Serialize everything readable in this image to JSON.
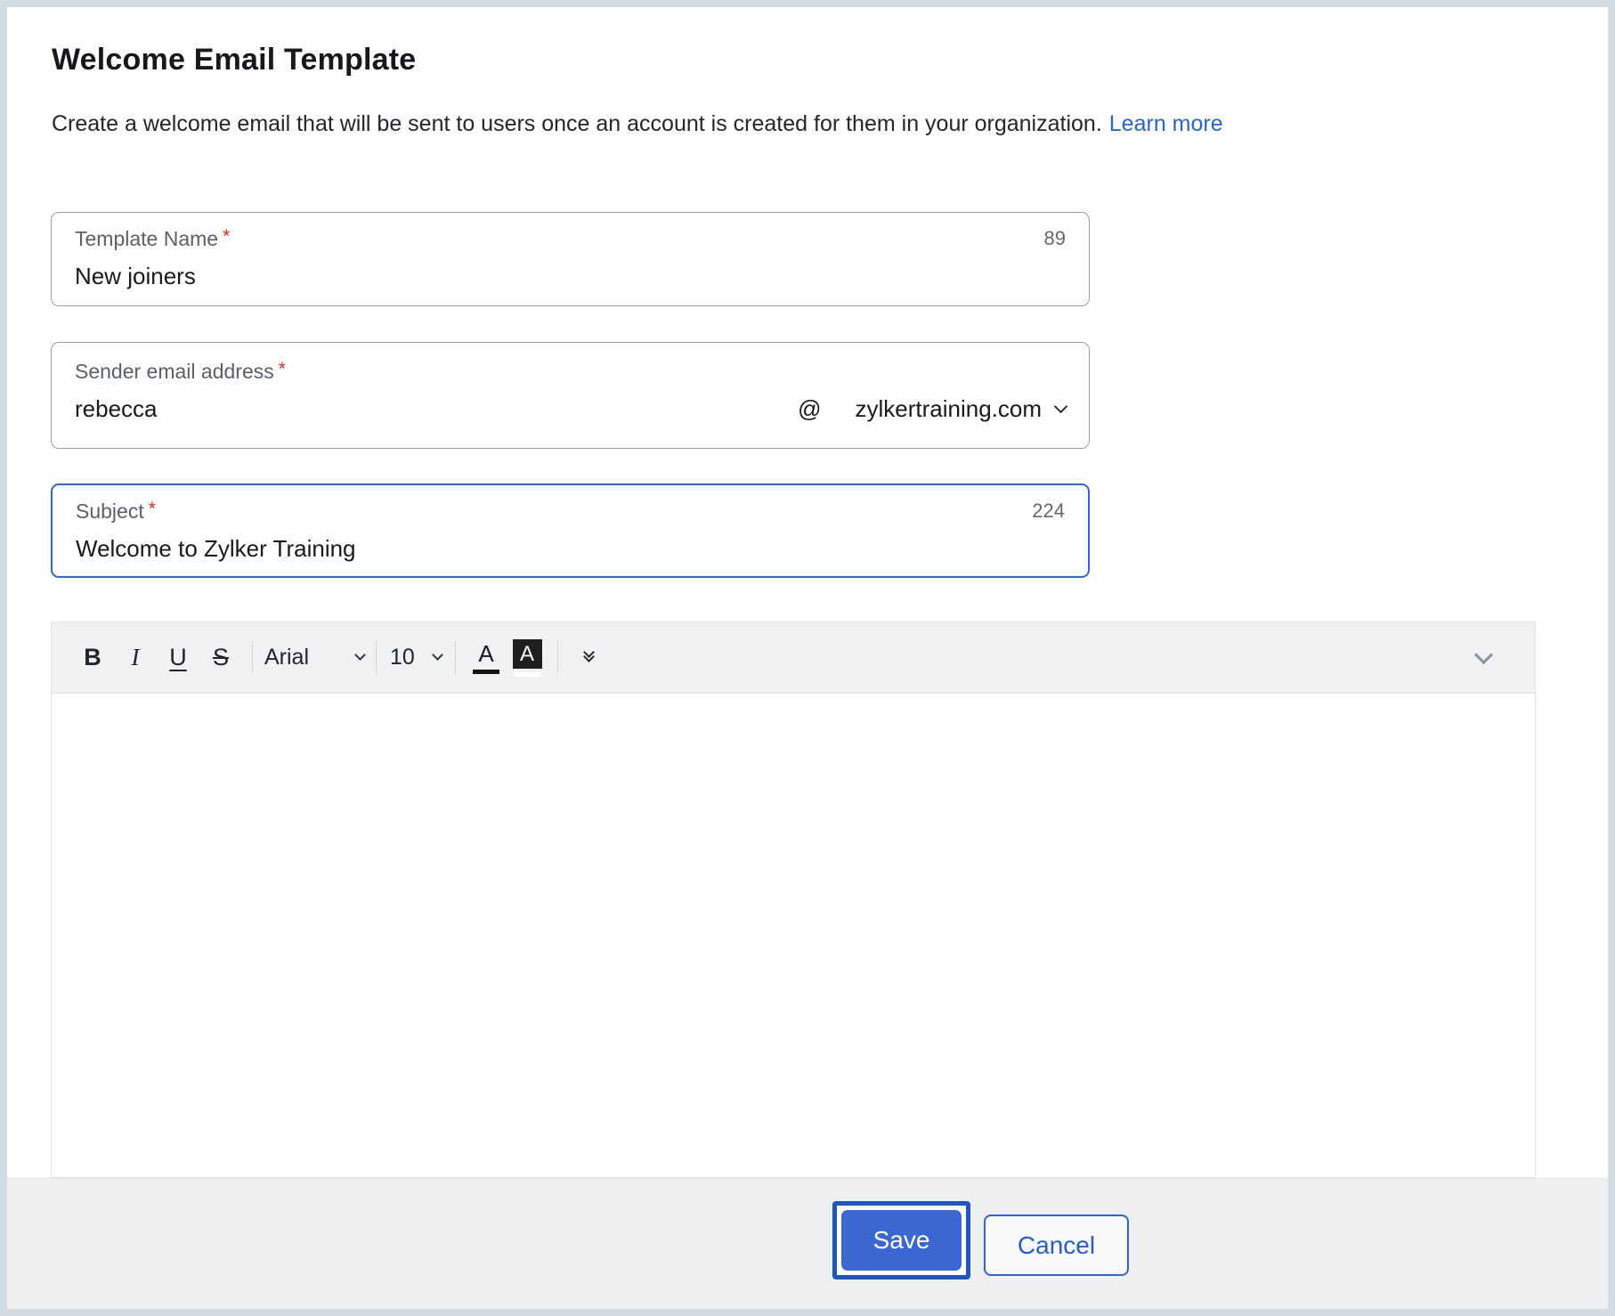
{
  "header": {
    "title": "Welcome Email Template",
    "description": "Create a welcome email that will be sent to users once an account is created for them in your organization.",
    "learn_more_label": "Learn more"
  },
  "fields": {
    "template_name": {
      "label": "Template Name",
      "required_mark": "*",
      "value": "New joiners",
      "char_count": "89"
    },
    "sender_email": {
      "label": "Sender email address",
      "required_mark": "*",
      "value": "rebecca",
      "separator": "@",
      "domain": "zylkertraining.com"
    },
    "subject": {
      "label": "Subject",
      "required_mark": "*",
      "value": "Welcome to Zylker Training",
      "char_count": "224"
    }
  },
  "editor": {
    "toolbar": {
      "bold_label": "B",
      "italic_label": "I",
      "underline_label": "U",
      "strikethrough_label": "S",
      "font_family_value": "Arial",
      "font_size_value": "10",
      "font_color_label": "A",
      "highlight_label": "A"
    },
    "body_text": ""
  },
  "footer": {
    "save_label": "Save",
    "cancel_label": "Cancel"
  },
  "colors": {
    "accent_blue": "#3465cf",
    "link_blue": "#2c64c6",
    "required_red": "#cc2e24",
    "save_fill": "#3a67d2",
    "focus_ring": "#1f55bd",
    "toolbar_bg": "#f0f1f3",
    "footer_bg": "#edeff1",
    "page_border": "#d3dce3"
  }
}
